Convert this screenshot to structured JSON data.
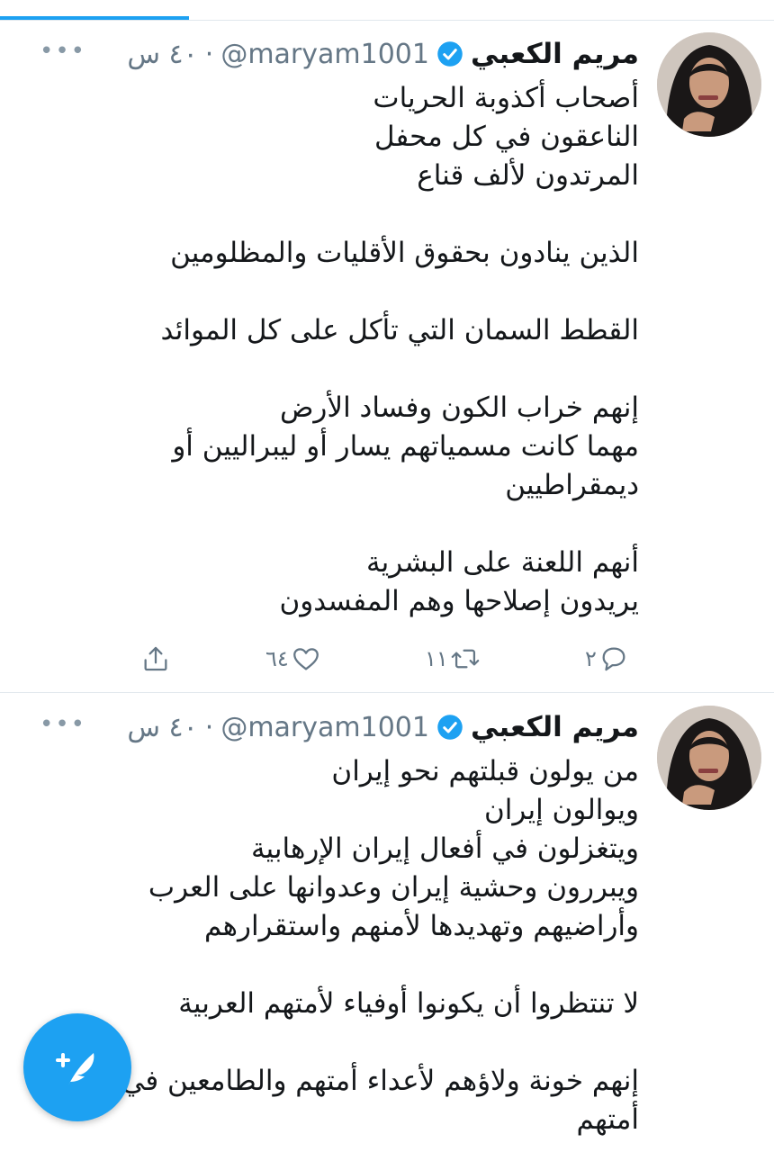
{
  "colors": {
    "accent": "#1da1f2",
    "secondary_text": "#657786",
    "divider": "#e1e8ed"
  },
  "tweets": [
    {
      "author_name": "مريم الكعبي",
      "handle": "@maryam1001",
      "separator": "·",
      "time": "٤٠ س",
      "lines": [
        "أصحاب أكذوبة الحريات",
        "الناعقون في كل محفل",
        "المرتدون لألف قناع",
        "",
        "الذين ينادون بحقوق الأقليات والمظلومين",
        "",
        "القطط السمان التي تأكل على كل الموائد",
        "",
        "إنهم خراب الكون وفساد الأرض",
        "مهما كانت مسمياتهم يسار أو ليبراليين أو",
        "ديمقراطيين",
        "",
        "أنهم اللعنة على البشرية",
        "يريدون إصلاحها وهم المفسدون"
      ],
      "reply_count": "٢",
      "retweet_count": "١١",
      "like_count": "٦٤"
    },
    {
      "author_name": "مريم الكعبي",
      "handle": "@maryam1001",
      "separator": "·",
      "time": "٤٠ س",
      "lines": [
        "من يولون قبلتهم نحو إيران",
        "ويوالون إيران",
        "ويتغزلون في أفعال إيران الإرهابية",
        "ويبررون وحشية إيران وعدوانها على العرب",
        "وأراضيهم وتهديدها لأمنهم واستقرارهم",
        "",
        "لا تنتظروا أن يكونوا أوفياء لأمتهم العربية",
        "",
        "إنهم خونة ولاؤهم لأعداء أمتهم والطامعين في",
        "أمتهم"
      ]
    }
  ],
  "icons": {
    "more": "more-dots-icon",
    "verified": "verified-badge-icon",
    "reply": "reply-icon",
    "retweet": "retweet-icon",
    "like": "heart-icon",
    "share": "share-icon",
    "compose": "compose-tweet-icon"
  }
}
